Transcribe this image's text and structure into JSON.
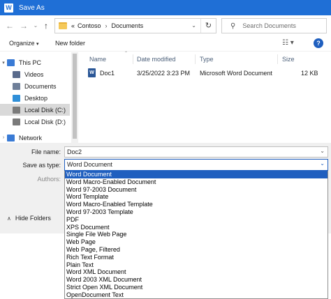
{
  "window": {
    "title": "Save As",
    "app_icon": "W"
  },
  "nav": {
    "back_icon": "arrow-left-icon",
    "forward_icon": "arrow-right-icon",
    "recent_icon": "chevron-down-icon",
    "up_icon": "arrow-up-icon",
    "breadcrumb": {
      "prefix": "«",
      "items": [
        "Contoso",
        "Documents"
      ]
    },
    "search_placeholder": "Search Documents"
  },
  "toolbar": {
    "organize_label": "Organize",
    "new_folder_label": "New folder"
  },
  "sidebar": {
    "items": [
      {
        "label": "This PC",
        "icon": "pc-icon",
        "color": "#3a7bd5"
      },
      {
        "label": "Videos",
        "icon": "videos-icon",
        "color": "#5a6b8c"
      },
      {
        "label": "Documents",
        "icon": "documents-icon",
        "color": "#6f7f99"
      },
      {
        "label": "Desktop",
        "icon": "desktop-icon",
        "color": "#2f8fd8"
      },
      {
        "label": "Local Disk (C:)",
        "icon": "disk-icon",
        "color": "#7a7a7a",
        "selected": true
      },
      {
        "label": "Local Disk (D:)",
        "icon": "disk-icon",
        "color": "#7a7a7a"
      },
      {
        "label": "Network",
        "icon": "network-icon",
        "color": "#3a7bd5"
      }
    ]
  },
  "filelist": {
    "columns": [
      "Name",
      "Date modified",
      "Type",
      "Size"
    ],
    "rows": [
      {
        "name": "Doc1",
        "date": "3/25/2022 3:23 PM",
        "type": "Microsoft Word Document",
        "size": "12 KB"
      }
    ]
  },
  "form": {
    "file_name_label": "File name:",
    "file_name_value": "Doc2",
    "save_as_type_label": "Save as type:",
    "save_as_type_value": "Word Document",
    "authors_label": "Authors:",
    "hide_folders_label": "Hide Folders"
  },
  "type_options": [
    "Word Document",
    "Word Macro-Enabled Document",
    "Word 97-2003 Document",
    "Word Template",
    "Word Macro-Enabled Template",
    "Word 97-2003 Template",
    "PDF",
    "XPS Document",
    "Single File Web Page",
    "Web Page",
    "Web Page, Filtered",
    "Rich Text Format",
    "Plain Text",
    "Word XML Document",
    "Word 2003 XML Document",
    "Strict Open XML Document",
    "OpenDocument Text"
  ],
  "colors": {
    "accent": "#1f5fbf",
    "titlebar": "#1f6fd6"
  }
}
